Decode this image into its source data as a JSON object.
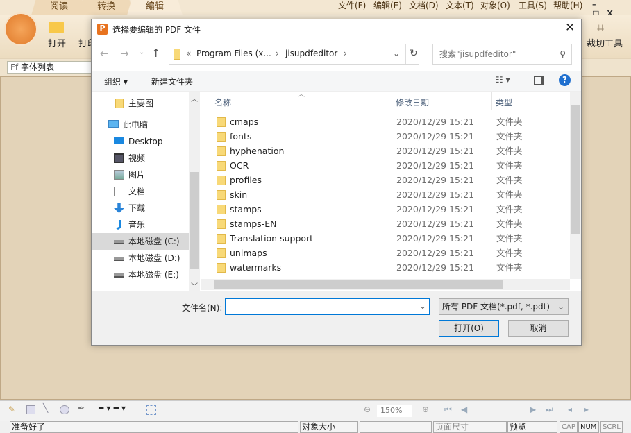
{
  "app": {
    "tabs": [
      "阅读",
      "转换",
      "编辑"
    ],
    "menu": [
      "文件(F)",
      "编辑(E)",
      "文档(D)",
      "文本(T)",
      "对象(O)",
      "工具(S)",
      "帮助(H)"
    ],
    "toolbar": {
      "open": "打开",
      "print": "打印",
      "crop": "裁切工具"
    },
    "font_list": "字体列表",
    "zoom": "150%",
    "status": {
      "ready": "准备好了",
      "object_size": "对象大小",
      "page_size": "页面尺寸",
      "preview": "预览",
      "cap": "CAP",
      "num": "NUM",
      "scrl": "SCRL"
    }
  },
  "dialog": {
    "title": "选择要编辑的 PDF 文件",
    "breadcrumb": [
      "«",
      "Program Files (x...",
      "jisupdfeditor"
    ],
    "search_placeholder": "搜索\"jisupdfeditor\"",
    "organize": "组织",
    "new_folder": "新建文件夹",
    "sidebar": [
      {
        "label": "主要图",
        "icon": "folder-icon"
      },
      {
        "label": "此电脑",
        "icon": "computer-icon"
      },
      {
        "label": "Desktop",
        "icon": "desktop-icon"
      },
      {
        "label": "视频",
        "icon": "video-icon"
      },
      {
        "label": "图片",
        "icon": "picture-icon"
      },
      {
        "label": "文档",
        "icon": "document-icon"
      },
      {
        "label": "下载",
        "icon": "download-icon"
      },
      {
        "label": "音乐",
        "icon": "music-icon"
      },
      {
        "label": "本地磁盘 (C:)",
        "icon": "drive-icon",
        "selected": true
      },
      {
        "label": "本地磁盘 (D:)",
        "icon": "drive-icon"
      },
      {
        "label": "本地磁盘 (E:)",
        "icon": "drive-icon"
      }
    ],
    "columns": [
      "名称",
      "修改日期",
      "类型"
    ],
    "files": [
      {
        "name": "cmaps",
        "date": "2020/12/29 15:21",
        "type": "文件夹"
      },
      {
        "name": "fonts",
        "date": "2020/12/29 15:21",
        "type": "文件夹"
      },
      {
        "name": "hyphenation",
        "date": "2020/12/29 15:21",
        "type": "文件夹"
      },
      {
        "name": "OCR",
        "date": "2020/12/29 15:21",
        "type": "文件夹"
      },
      {
        "name": "profiles",
        "date": "2020/12/29 15:21",
        "type": "文件夹"
      },
      {
        "name": "skin",
        "date": "2020/12/29 15:21",
        "type": "文件夹"
      },
      {
        "name": "stamps",
        "date": "2020/12/29 15:21",
        "type": "文件夹"
      },
      {
        "name": "stamps-EN",
        "date": "2020/12/29 15:21",
        "type": "文件夹"
      },
      {
        "name": "Translation support",
        "date": "2020/12/29 15:21",
        "type": "文件夹"
      },
      {
        "name": "unimaps",
        "date": "2020/12/29 15:21",
        "type": "文件夹"
      },
      {
        "name": "watermarks",
        "date": "2020/12/29 15:21",
        "type": "文件夹"
      }
    ],
    "filename_label": "文件名(N):",
    "filename_value": "",
    "filetype": "所有 PDF 文档(*.pdf, *.pdt)",
    "open": "打开(O)",
    "cancel": "取消"
  }
}
